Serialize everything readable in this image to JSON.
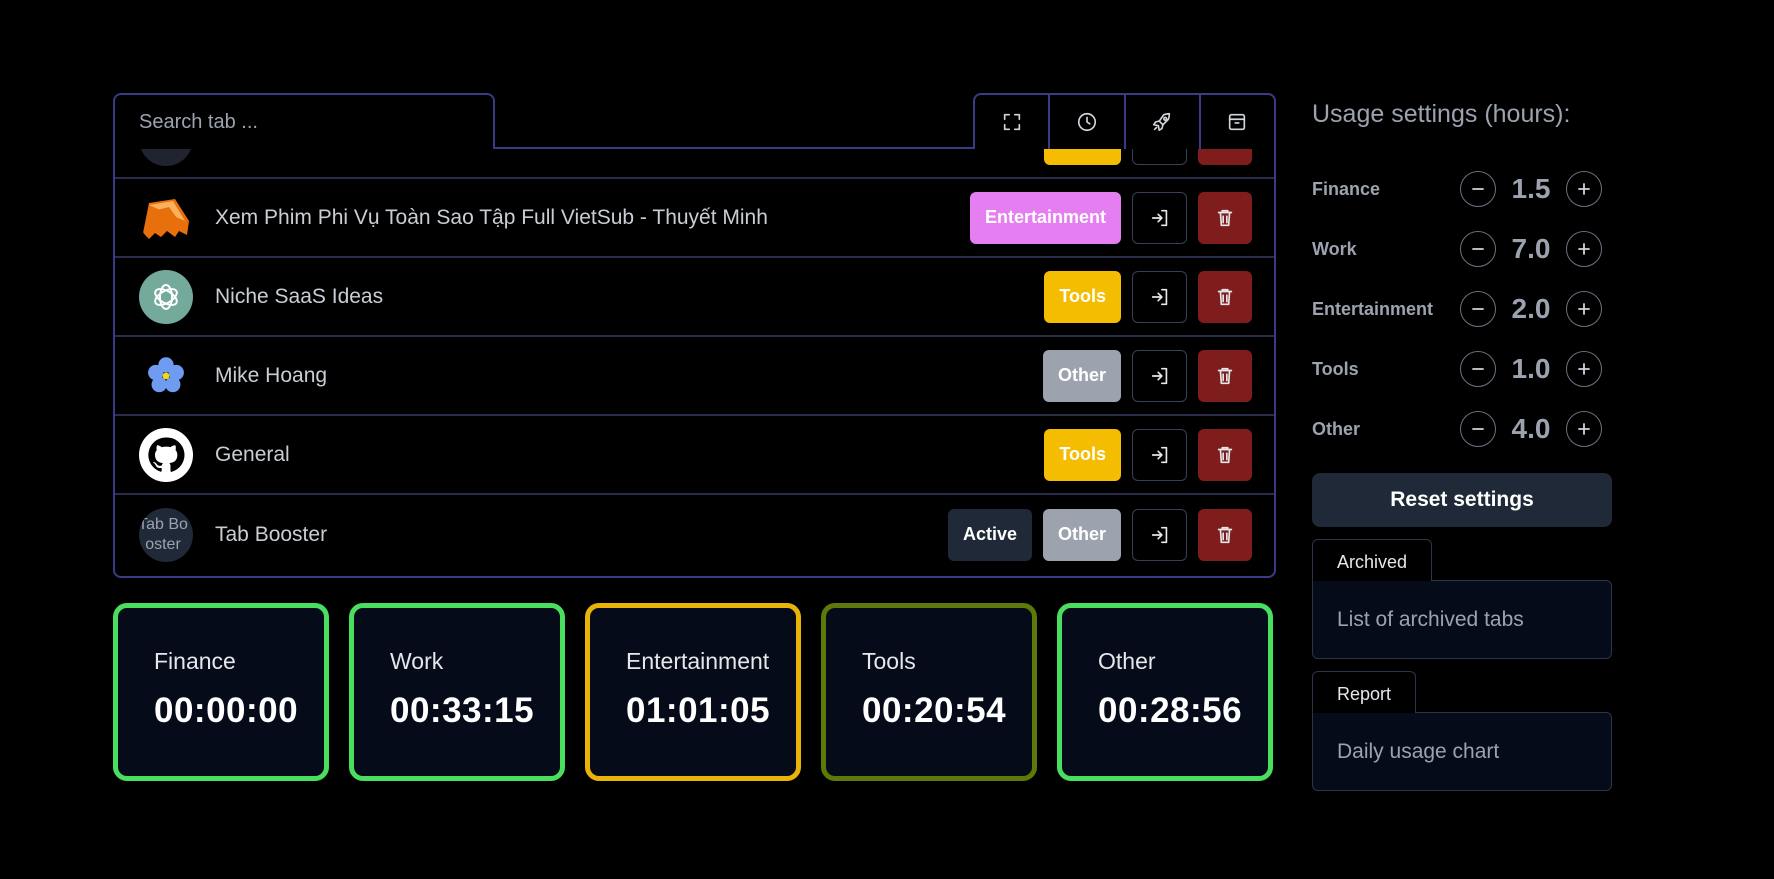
{
  "search": {
    "placeholder": "Search tab ..."
  },
  "toolbar": [
    {
      "icon": "fullscreen-icon"
    },
    {
      "icon": "clock-icon"
    },
    {
      "icon": "rocket-icon"
    },
    {
      "icon": "archive-icon"
    }
  ],
  "tabs": [
    {
      "title": "",
      "category": "Tools",
      "active": false,
      "favicon": "partial-icon"
    },
    {
      "title": "Xem Phim Phi Vụ Toàn Sao Tập Full VietSub - Thuyết Minh",
      "category": "Entertainment",
      "active": false,
      "favicon": "film-icon"
    },
    {
      "title": "Niche SaaS Ideas",
      "category": "Tools",
      "active": false,
      "favicon": "chatgpt-icon"
    },
    {
      "title": "Mike Hoang",
      "category": "Other",
      "active": false,
      "favicon": "flower-icon"
    },
    {
      "title": "General",
      "category": "Tools",
      "active": false,
      "favicon": "github-icon"
    },
    {
      "title": "Tab Booster",
      "category": "Other",
      "active": true,
      "active_label": "Active",
      "favicon": "tab-booster-icon",
      "favicon_text": "Tab Booster"
    }
  ],
  "timers": [
    {
      "label": "Finance",
      "value": "00:00:00",
      "color": "#4ade5f"
    },
    {
      "label": "Work",
      "value": "00:33:15",
      "color": "#4ade5f"
    },
    {
      "label": "Entertainment",
      "value": "01:01:05",
      "color": "#eab308"
    },
    {
      "label": "Tools",
      "value": "00:20:54",
      "color": "#5d7a08"
    },
    {
      "label": "Other",
      "value": "00:28:56",
      "color": "#4ade5f"
    }
  ],
  "settings": {
    "title": "Usage settings (hours):",
    "items": [
      {
        "label": "Finance",
        "value": "1.5"
      },
      {
        "label": "Work",
        "value": "7.0"
      },
      {
        "label": "Entertainment",
        "value": "2.0"
      },
      {
        "label": "Tools",
        "value": "1.0"
      },
      {
        "label": "Other",
        "value": "4.0"
      }
    ],
    "reset_label": "Reset settings"
  },
  "archived": {
    "tab": "Archived",
    "body": "List of archived tabs"
  },
  "report": {
    "tab": "Report",
    "body": "Daily usage chart"
  },
  "colors": {
    "accent_border": "#3b3a86",
    "entertainment": "#e57ef0",
    "tools": "#f5bd02",
    "other": "#9ca3af",
    "delete": "#7f1d1d"
  }
}
